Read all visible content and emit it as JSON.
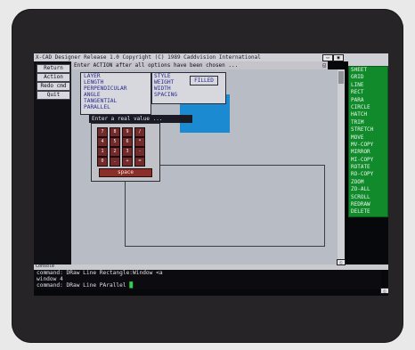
{
  "window": {
    "title": "X-CAD Designer Release 1.0  Copyright (C) 1989 Caddvision International"
  },
  "left_commands": [
    "Return",
    "Action",
    "Redo cmd",
    "Quit"
  ],
  "status_message": "Enter ACTION after all options have been chosen ...",
  "options_panel": [
    "LAYER",
    "LENGTH",
    "PERPENDICULAR",
    "ANGLE",
    "TANGENTIAL",
    "PARALLEL"
  ],
  "style_panel": [
    "STYLE",
    "WEIGHT",
    "WIDTH",
    "SPACING"
  ],
  "filled_label": "FILLED",
  "prompt_text": "Enter a real value ...",
  "keypad": {
    "rows": [
      [
        "7",
        "8",
        "9",
        "/"
      ],
      [
        "4",
        "5",
        "6",
        "*"
      ],
      [
        "1",
        "2",
        "3",
        "-"
      ],
      [
        "0",
        ".",
        "+",
        "="
      ]
    ],
    "space_label": "space"
  },
  "right_menu": [
    "SHEET",
    "GRID",
    "LINE",
    "RECT",
    "PARA",
    "CIRCLE",
    "HATCH",
    "TRIM",
    "STRETCH",
    "MOVE",
    "MV-COPY",
    "MIRROR",
    "MI-COPY",
    "ROTATE",
    "RO-COPY",
    "ZOOM",
    "ZO-ALL",
    "SCROLL",
    "REDRAW",
    "DELETE"
  ],
  "console": {
    "label": "Console",
    "lines": [
      "command: DRaw Line Rectangle:Window <a",
      "window 4",
      "command: DRaw Line PArallel"
    ],
    "cursor": "█"
  },
  "colors": {
    "accent_green": "#118a2c",
    "keypad_red": "#722a2a",
    "highlight_blue": "#1c8ad0"
  }
}
